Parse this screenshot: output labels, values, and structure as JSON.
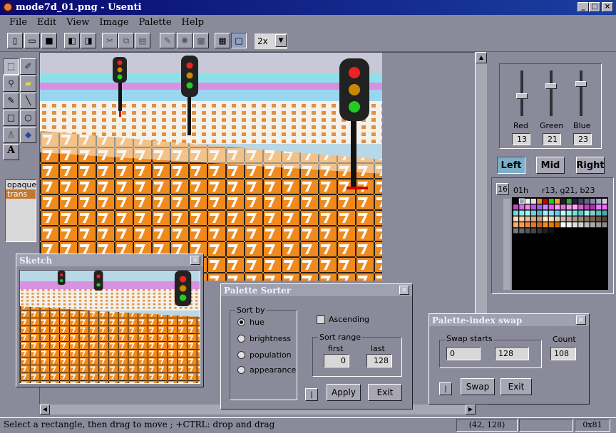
{
  "window": {
    "title": "mode7d_01.png - Usenti",
    "min_label": "_",
    "max_label": "□",
    "close_label": "×"
  },
  "menu": [
    "File",
    "Edit",
    "View",
    "Image",
    "Palette",
    "Help"
  ],
  "toolbar": {
    "zoom": "2x"
  },
  "layers": [
    "opaque",
    "trans"
  ],
  "sliders": {
    "red_label": "Red",
    "green_label": "Green",
    "blue_label": "Blue",
    "red": "13",
    "green": "21",
    "blue": "23",
    "red_level": 0.42,
    "green_level": 0.68,
    "blue_level": 0.74
  },
  "palette_buttons": {
    "left": "Left",
    "mid": "Mid",
    "right": "Right"
  },
  "palette_info": {
    "size": "16",
    "index": "01h",
    "rgb": "r13, g21, b23"
  },
  "sketch": {
    "title": "Sketch"
  },
  "sorter": {
    "title": "Palette Sorter",
    "sort_by": "Sort by",
    "options": [
      "hue",
      "brightness",
      "population",
      "appearance"
    ],
    "ascending": "Ascending",
    "sort_range": "Sort range",
    "first_label": "first",
    "last_label": "last",
    "first": "0",
    "last": "128",
    "apply": "Apply",
    "exit": "Exit",
    "small_btn": "|"
  },
  "swap": {
    "title": "Palette-index swap",
    "swap_starts": "Swap starts",
    "count_label": "Count",
    "start_a": "0",
    "start_b": "128",
    "count": "108",
    "swap_btn": "Swap",
    "exit": "Exit",
    "small_btn": "|"
  },
  "status": {
    "message": "Select a rectangle, then drag to move ; +CTRL: drop and drag",
    "coords": "(42, 128)",
    "mode": "0x81"
  },
  "colors": {
    "title_start": "#0a0a6e",
    "title_end": "#1a3fa0",
    "face": "#8a8a9a",
    "selected_tab": "#7ab0c8"
  }
}
